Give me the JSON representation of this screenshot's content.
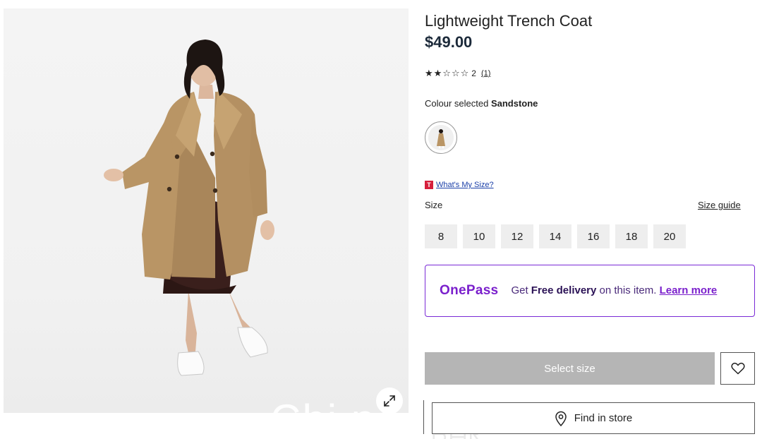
{
  "product": {
    "title": "Lightweight Trench Coat",
    "price": "$49.00",
    "image_alt": "Woman wearing sandstone lightweight trench coat over a dark dress with white sneakers"
  },
  "rating": {
    "stars_display": "★★☆☆☆",
    "value": "2",
    "count_link": "(1)",
    "score_out_of_5": 2
  },
  "colour": {
    "prefix": "Colour selected",
    "selected": "Sandstone"
  },
  "size_help": {
    "logo_letter": "T",
    "link": "What's My Size?"
  },
  "size": {
    "label": "Size",
    "guide_link": "Size guide",
    "options": [
      "8",
      "10",
      "12",
      "14",
      "16",
      "18",
      "20"
    ]
  },
  "onepass": {
    "logo": "OnePass",
    "text_before": "Get ",
    "text_bold": "Free delivery",
    "text_after": " on this item.",
    "link": "Learn more"
  },
  "actions": {
    "select_size": "Select size",
    "find_in_store": "Find in store"
  },
  "icons": {
    "expand": "expand-icon",
    "wishlist": "heart-icon",
    "store": "location-pin-icon"
  },
  "watermark": {
    "text": "Chi  ne",
    "tail": "ᗷᗩᖇ"
  },
  "colors": {
    "price": "#1c2a3a",
    "onepass_purple": "#7a1fcc",
    "select_disabled": "#b5b5b5",
    "size_bg": "#eeeeee",
    "link_blue": "#1a3fa8"
  }
}
